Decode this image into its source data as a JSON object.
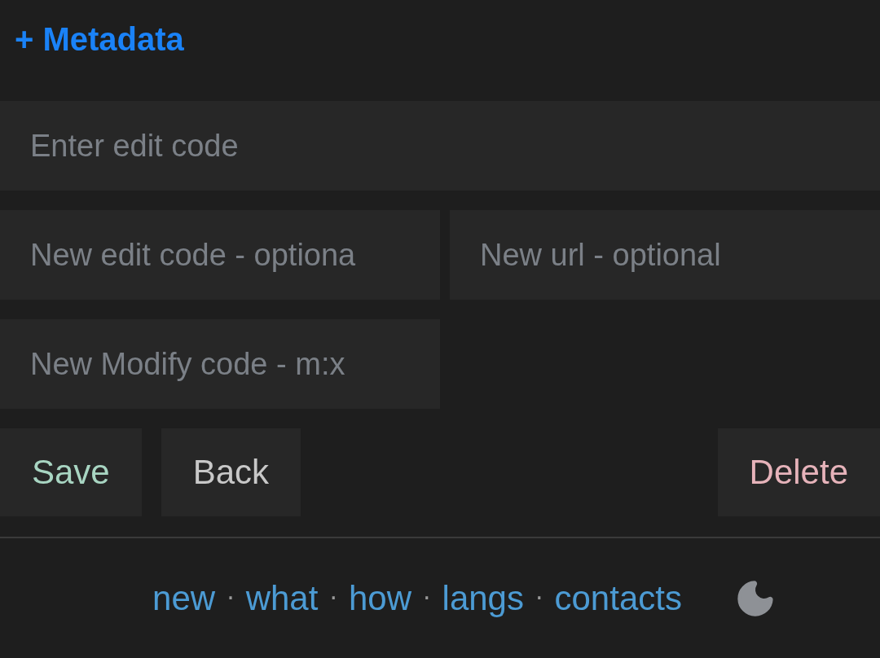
{
  "metadata_link": "+ Metadata",
  "fields": [
    {
      "placeholder": "Enter edit code",
      "kind": "full"
    },
    {
      "placeholder": "New edit code - optiona",
      "kind": "half"
    },
    {
      "placeholder": "New url - optional",
      "kind": "half"
    },
    {
      "placeholder": "New Modify code - m:x",
      "kind": "half"
    }
  ],
  "buttons": [
    {
      "label": "Save",
      "kind": "save"
    },
    {
      "label": "Back",
      "kind": "back"
    },
    {
      "label": "Delete",
      "kind": "delete"
    }
  ],
  "footer": {
    "links": [
      {
        "label": "new"
      },
      {
        "label": "what"
      },
      {
        "label": "how"
      },
      {
        "label": "langs"
      },
      {
        "label": "contacts"
      }
    ],
    "separators": [
      "·",
      "·",
      "·",
      "·"
    ]
  }
}
